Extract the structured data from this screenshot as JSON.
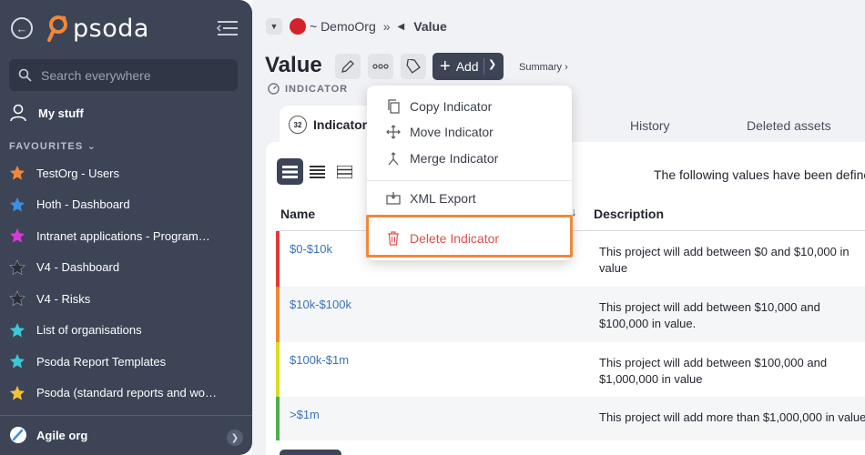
{
  "sidebar": {
    "logo_text": "psoda",
    "search_placeholder": "Search everywhere",
    "my_stuff": "My stuff",
    "favourites_label": "FAVOURITES",
    "favourites": [
      {
        "label": "TestOrg - Users",
        "color": "#f0883a"
      },
      {
        "label": "Hoth - Dashboard",
        "color": "#3d8fe0"
      },
      {
        "label": "Intranet applications - Programme...",
        "color": "#d63ad6"
      },
      {
        "label": "V4 - Dashboard",
        "color": "#2b2f3a"
      },
      {
        "label": "V4 - Risks",
        "color": "#2b2f3a"
      },
      {
        "label": "List of organisations",
        "color": "#3cc8d6"
      },
      {
        "label": "Psoda Report Templates",
        "color": "#3cc8d6"
      },
      {
        "label": "Psoda (standard reports and work...",
        "color": "#f0c23a"
      }
    ],
    "org_switcher": "Agile org"
  },
  "breadcrumb": {
    "org": "~ DemoOrg",
    "separator": "»",
    "current": "Value"
  },
  "header": {
    "title": "Value",
    "add_label": "Add",
    "summary_label": "Summary ›",
    "type_label": "INDICATOR"
  },
  "tabs": {
    "active": {
      "label": "Indicator",
      "count": "32"
    },
    "history": "History",
    "deleted": "Deleted assets"
  },
  "content": {
    "info_text": "The following values have been defined",
    "columns": {
      "name": "Name",
      "description": "Description"
    },
    "rows": [
      {
        "name": "$0-$10k",
        "description": "This project will add between $0 and $10,000 in value",
        "color": "#e53935"
      },
      {
        "name": "$10k-$100k",
        "description": "This project will add between $10,000 and $100,000 in value.",
        "color": "#f0883a"
      },
      {
        "name": "$100k-$1m",
        "description": "This project will add between $100,000 and $1,000,000 in value",
        "color": "#d9dd22"
      },
      {
        "name": ">$1m",
        "description": "This project will add more than $1,000,000 in value",
        "color": "#4caf50"
      }
    ]
  },
  "menu": {
    "copy": "Copy Indicator",
    "move": "Move Indicator",
    "merge": "Merge Indicator",
    "xml": "XML Export",
    "delete": "Delete Indicator"
  },
  "colors": {
    "sidebar_bg": "#3c4456",
    "link": "#3a73b8",
    "highlight": "#f0883a",
    "danger": "#e0504a"
  }
}
